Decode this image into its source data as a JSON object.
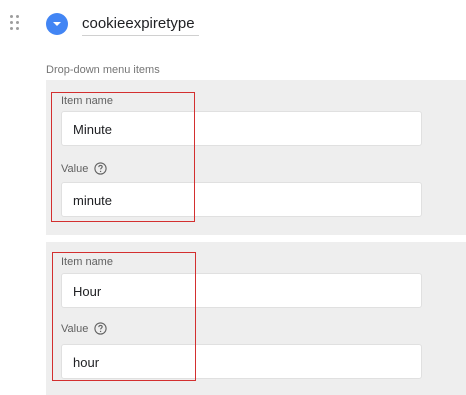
{
  "field": {
    "name": "cookieexpiretype"
  },
  "section_label": "Drop-down menu items",
  "items": [
    {
      "item_name_label": "Item name",
      "item_name_value": "Minute",
      "value_label": "Value",
      "value_value": "minute"
    },
    {
      "item_name_label": "Item name",
      "item_name_value": "Hour",
      "value_label": "Value",
      "value_value": "hour"
    }
  ],
  "colors": {
    "accent": "#4285f4",
    "highlight": "#d32f2f",
    "card_background": "#eeeeee"
  },
  "icons": {
    "toggle": "chevron-down-icon",
    "handle": "drag-handle-icon",
    "help": "help-circle-icon"
  }
}
